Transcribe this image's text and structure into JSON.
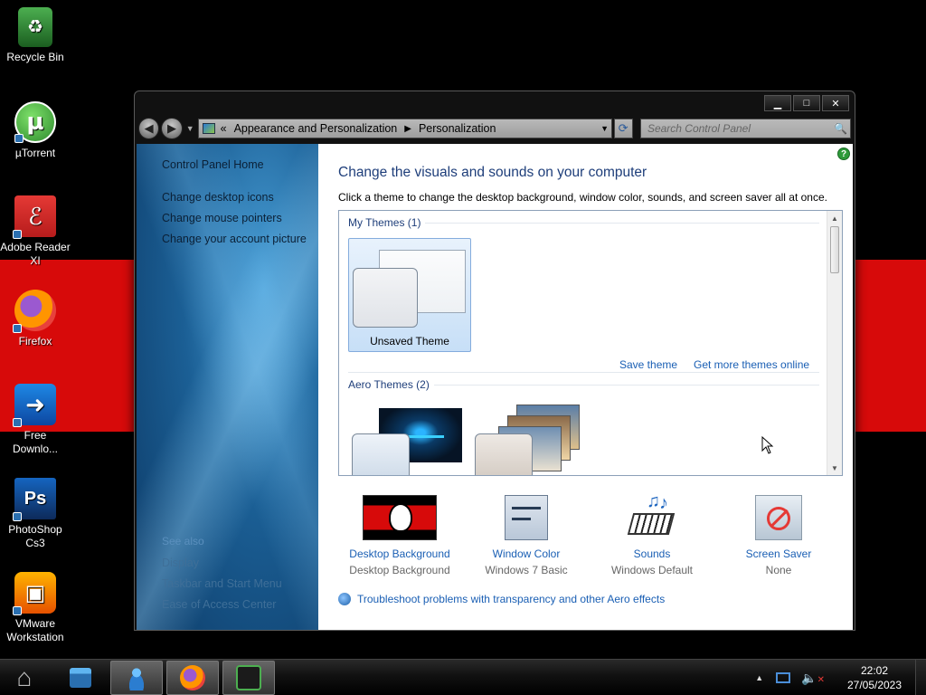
{
  "desktop": {
    "icons": [
      {
        "label": "Recycle Bin",
        "icon": "recycle-bin-icon"
      },
      {
        "label": "µTorrent",
        "icon": "utorrent-icon"
      },
      {
        "label": "Adobe Reader XI",
        "icon": "adobe-reader-icon"
      },
      {
        "label": "Firefox",
        "icon": "firefox-icon"
      },
      {
        "label": "Free Downlo...",
        "icon": "free-download-manager-icon"
      },
      {
        "label": "PhotoShop Cs3",
        "icon": "photoshop-icon"
      },
      {
        "label": "VMware Workstation",
        "icon": "vmware-icon"
      }
    ],
    "colors": {
      "band": "#d70a0a",
      "background": "#000000"
    }
  },
  "window": {
    "controls": {
      "minimize": "▁",
      "maximize": "□",
      "close": "✕"
    },
    "nav": {
      "back": "◀",
      "forward": "▶"
    },
    "address": {
      "prefix": "«",
      "crumbs": [
        "Appearance and Personalization",
        "Personalization"
      ]
    },
    "search": {
      "placeholder": "Search Control Panel"
    },
    "sidebar": {
      "home": "Control Panel Home",
      "links": [
        "Change desktop icons",
        "Change mouse pointers",
        "Change your account picture"
      ],
      "see_also": "See also",
      "see_also_links": [
        "Display",
        "Taskbar and Start Menu",
        "Ease of Access Center"
      ]
    },
    "main": {
      "help": "?",
      "title": "Change the visuals and sounds on your computer",
      "subtitle": "Click a theme to change the desktop background, window color, sounds, and screen saver all at once.",
      "groups": {
        "my_themes": "My Themes (1)",
        "aero_themes": "Aero Themes (2)"
      },
      "unsaved_theme": "Unsaved Theme",
      "save_theme": "Save theme",
      "get_more": "Get more themes online",
      "bottom": [
        {
          "title": "Desktop Background",
          "value": "Desktop Background"
        },
        {
          "title": "Window Color",
          "value": "Windows 7 Basic"
        },
        {
          "title": "Sounds",
          "value": "Windows Default"
        },
        {
          "title": "Screen Saver",
          "value": "None"
        }
      ],
      "troubleshoot": "Troubleshoot problems with transparency and other Aero effects"
    }
  },
  "taskbar": {
    "clock_time": "22:02",
    "clock_date": "27/05/2023",
    "tray_up": "▲"
  }
}
